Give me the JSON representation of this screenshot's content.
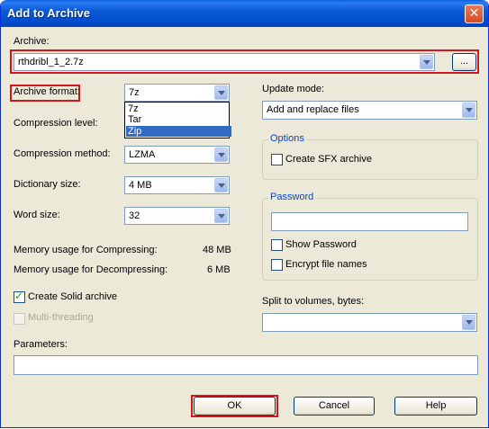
{
  "window": {
    "title": "Add to Archive",
    "close": "✕"
  },
  "archive": {
    "label": "Archive:",
    "value": "rthdribl_1_2.7z",
    "browse": "..."
  },
  "format": {
    "label": "Archive format:",
    "value": "7z",
    "options": [
      "7z",
      "Tar",
      "Zip"
    ],
    "highlighted": "Zip"
  },
  "compression_level": {
    "label": "Compression level:"
  },
  "compression_method": {
    "label": "Compression method:",
    "value": "LZMA"
  },
  "dictionary": {
    "label": "Dictionary size:",
    "value": "4 MB"
  },
  "word": {
    "label": "Word size:",
    "value": "32"
  },
  "memory": {
    "compress_label": "Memory usage for Compressing:",
    "compress_value": "48 MB",
    "decompress_label": "Memory usage for Decompressing:",
    "decompress_value": "6 MB"
  },
  "solid": {
    "label": "Create Solid archive",
    "checked": true
  },
  "multithreading": {
    "label": "Multi-threading",
    "checked": false,
    "enabled": false
  },
  "parameters": {
    "label": "Parameters:",
    "value": ""
  },
  "update": {
    "label": "Update mode:",
    "value": "Add and replace files"
  },
  "options": {
    "title": "Options",
    "sfx_label": "Create SFX archive"
  },
  "password": {
    "title": "Password",
    "value": "",
    "show_label": "Show Password",
    "encrypt_label": "Encrypt file names"
  },
  "split": {
    "label": "Split to volumes, bytes:",
    "value": ""
  },
  "buttons": {
    "ok": "OK",
    "cancel": "Cancel",
    "help": "Help"
  }
}
